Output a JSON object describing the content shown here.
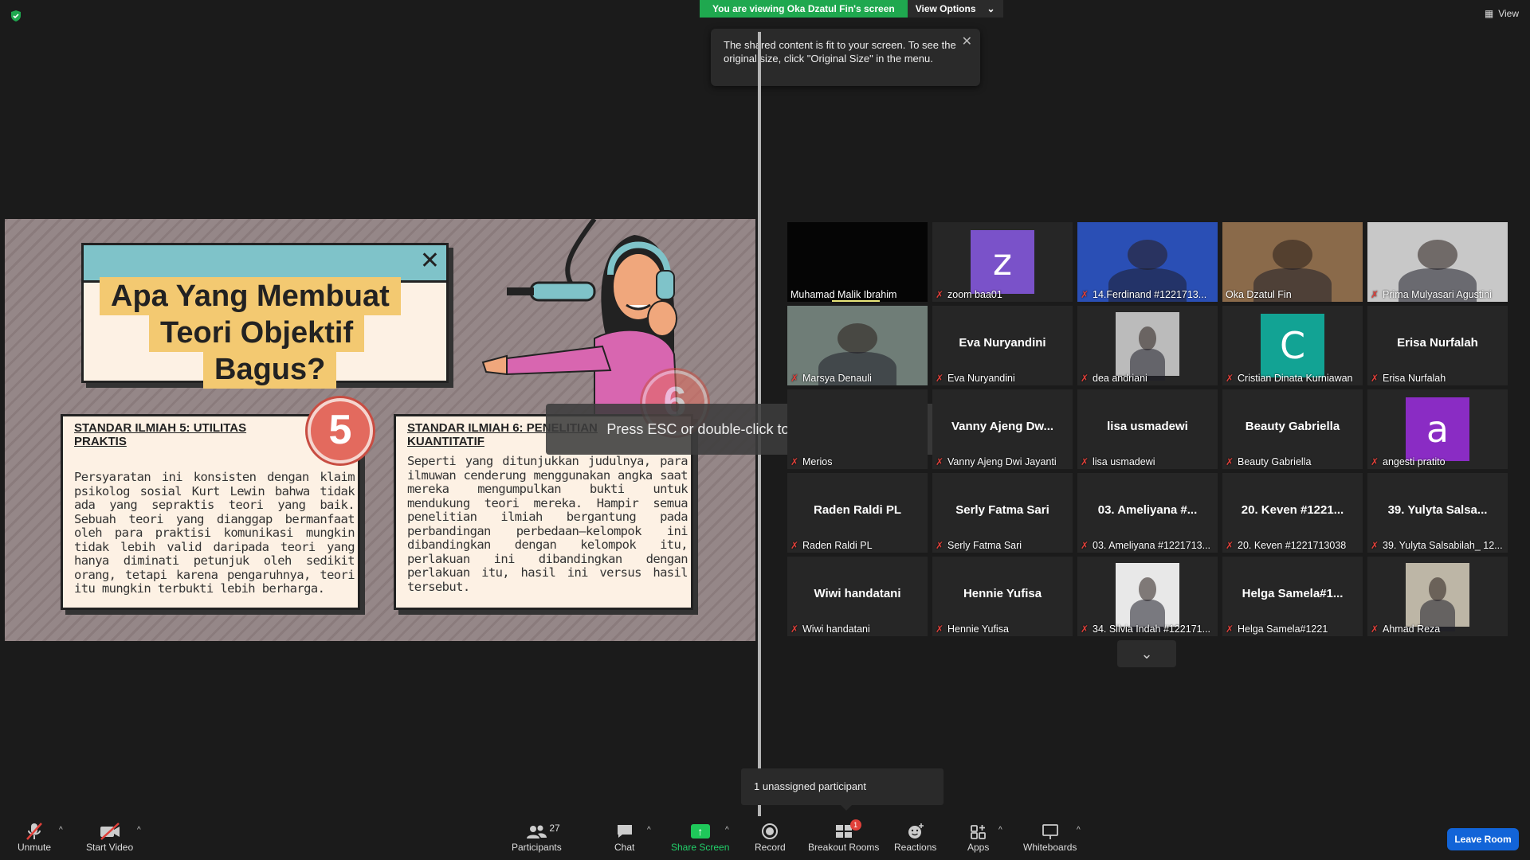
{
  "top": {
    "viewing_text": "You are viewing Oka Dzatul Fin's screen",
    "view_options": "View Options",
    "view_button": "View",
    "tooltip": "The shared content is fit to your screen. To see the original size, click \"Original Size\" in the menu."
  },
  "slide": {
    "title_line1": "Apa Yang Membuat",
    "title_line2": "Teori Objektif",
    "title_line3": "Bagus?",
    "card5_head": "STANDAR ILMIAH 5: UTILITAS PRAKTIS",
    "card5_body": "Persyaratan ini konsisten dengan klaim psikolog sosial Kurt Lewin bahwa tidak ada yang sepraktis teori yang baik. Sebuah teori yang dianggap bermanfaat oleh para praktisi komunikasi mungkin tidak lebih valid daripada teori yang hanya diminati petunjuk oleh sedikit orang, tetapi karena pengaruhnya, teori itu mungkin terbukti lebih berharga.",
    "badge5": "5",
    "card6_head": "STANDAR ILMIAH 6: PENELITIAN KUANTITATIF",
    "card6_body": "Seperti yang ditunjukkan judulnya, para ilmuwan cenderung menggunakan angka saat mereka mengumpulkan bukti untuk mendukung teori mereka. Hampir semua penelitian ilmiah bergantung pada perbandingan perbedaan—kelompok ini dibandingkan dengan kelompok itu, perlakuan ini dibandingkan dengan perlakuan itu, hasil ini versus hasil tersebut.",
    "badge6": "6"
  },
  "esc_message": "Press ESC or double-click to exit full screen mode",
  "gallery": [
    {
      "label": "Muhamad Malik Ibrahim",
      "center": "",
      "kind": "black",
      "muted": false
    },
    {
      "label": "zoom baa01",
      "center": "",
      "kind": "avatar",
      "letter": "z",
      "color": "#7a52c9",
      "muted": true
    },
    {
      "label": "14.Ferdinand #1221713...",
      "center": "",
      "kind": "photo-blue",
      "muted": true
    },
    {
      "label": "Oka Dzatul Fin",
      "center": "",
      "kind": "photo-room",
      "muted": false
    },
    {
      "label": "Prima Mulyasari Agustini",
      "center": "",
      "kind": "photo-light",
      "muted": true
    },
    {
      "label": "Marsya Denauli",
      "center": "",
      "kind": "photo-hijab",
      "muted": true
    },
    {
      "label": "Eva Nuryandini",
      "center": "Eva Nuryandini",
      "kind": "name",
      "muted": true
    },
    {
      "label": "dea andriani",
      "center": "",
      "kind": "photo-bw",
      "muted": true
    },
    {
      "label": "Cristian Dinata Kurniawan",
      "center": "",
      "kind": "avatar",
      "letter": "C",
      "color": "#12a394",
      "muted": true
    },
    {
      "label": "Erisa Nurfalah",
      "center": "Erisa Nurfalah",
      "kind": "name",
      "muted": true
    },
    {
      "label": "Merios",
      "center": "",
      "kind": "name",
      "muted": true
    },
    {
      "label": "Vanny Ajeng Dwi Jayanti",
      "center": "Vanny Ajeng Dw...",
      "kind": "name",
      "muted": true
    },
    {
      "label": "lisa usmadewi",
      "center": "lisa usmadewi",
      "kind": "name",
      "muted": true
    },
    {
      "label": "Beauty Gabriella",
      "center": "Beauty Gabriella",
      "kind": "name",
      "muted": true
    },
    {
      "label": "angesti pratito",
      "center": "",
      "kind": "avatar",
      "letter": "a",
      "color": "#8a2cc4",
      "muted": true
    },
    {
      "label": "Raden Raldi PL",
      "center": "Raden Raldi PL",
      "kind": "name",
      "muted": true
    },
    {
      "label": "Serly Fatma Sari",
      "center": "Serly Fatma Sari",
      "kind": "name",
      "muted": true
    },
    {
      "label": "03. Ameliyana #1221713...",
      "center": "03. Ameliyana #...",
      "kind": "name",
      "muted": true
    },
    {
      "label": "20. Keven #1221713038",
      "center": "20. Keven #1221...",
      "kind": "name",
      "muted": true
    },
    {
      "label": "39. Yulyta Salsabilah_ 12...",
      "center": "39. Yulyta Salsa...",
      "kind": "name",
      "muted": true
    },
    {
      "label": "Wiwi handatani",
      "center": "Wiwi handatani",
      "kind": "name",
      "muted": true
    },
    {
      "label": "Hennie Yufisa",
      "center": "Hennie Yufisa",
      "kind": "name",
      "muted": true
    },
    {
      "label": "34. Silvia Indah #122171...",
      "center": "",
      "kind": "photo-hijab2",
      "muted": true
    },
    {
      "label": "Helga Samela#1221",
      "center": "Helga  Samela#1...",
      "kind": "name",
      "muted": true
    },
    {
      "label": "Ahmad Reza",
      "center": "",
      "kind": "photo-street",
      "muted": true
    }
  ],
  "unassigned": "1 unassigned participant",
  "toolbar": {
    "unmute": "Unmute",
    "start_video": "Start Video",
    "participants": "Participants",
    "participants_count": "27",
    "chat": "Chat",
    "share_screen": "Share Screen",
    "record": "Record",
    "breakout": "Breakout Rooms",
    "breakout_badge": "1",
    "reactions": "Reactions",
    "apps": "Apps",
    "whiteboards": "Whiteboards",
    "leave": "Leave Room"
  },
  "colors": {
    "share_green": "#1fa84f",
    "leave_blue": "#1264d8",
    "active_speaker": "#e9e67a",
    "muted_red": "#e0403a"
  }
}
